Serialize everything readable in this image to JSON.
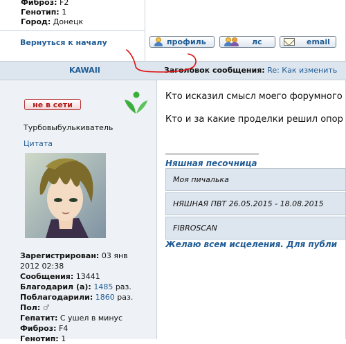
{
  "top_profile": {
    "fibrosis_label": "Фиброз:",
    "fibrosis_value": "F2",
    "genotype_label": "Генотип:",
    "genotype_value": "1",
    "city_label": "Город:",
    "city_value": "Донецк"
  },
  "back_link": "Вернуться к началу",
  "buttons": {
    "profile": "профиль",
    "pm": "лс",
    "email": "email"
  },
  "post": {
    "author": "KAWAII",
    "subject_label": "Заголовок сообщения:",
    "subject_value": "Re: Как изменить",
    "status": "не в сети",
    "rank": "Турбовыбулькиватель",
    "quote": "Цитата",
    "body_line1": "Кто исказил смысл моего форумного",
    "body_line2": "Кто и за какие проделки решил опор",
    "signature_title": "Няшная песочница",
    "signature_rows": [
      "Моя пичалька",
      "НЯШНАЯ ПВТ 26.05.2015 - 18.08.2015",
      "FIBROSCAN"
    ],
    "signature_footer": "Желаю всем исцеления. Для публи"
  },
  "author_details": {
    "registered_label": "Зарегистрирован:",
    "registered_value": "03 янв",
    "registered_value2": "2012 02:38",
    "messages_label": "Сообщения:",
    "messages_value": "13441",
    "thanked_label": "Благодарил (а):",
    "thanked_value": "1485",
    "thanked_suffix": "раз.",
    "thanks_recv_label": "Поблагодарили:",
    "thanks_recv_value": "1860",
    "thanks_recv_suffix": "раз.",
    "gender_label": "Пол:",
    "hepatitis_label": "Гепатит:",
    "hepatitis_value": "С ушел в минус",
    "fibrosis_label": "Фиброз:",
    "fibrosis_value": "F4",
    "genotype_label": "Генотип:",
    "genotype_value": "1"
  },
  "colors": {
    "link": "#1f5b94",
    "band": "#dde6ee",
    "offline": "#b11818",
    "annotation": "#e01010",
    "leaf": "#3cae3c"
  },
  "icons": [
    "person-icon",
    "two-persons-icon",
    "envelope-icon",
    "leaf-icon",
    "male-icon"
  ]
}
